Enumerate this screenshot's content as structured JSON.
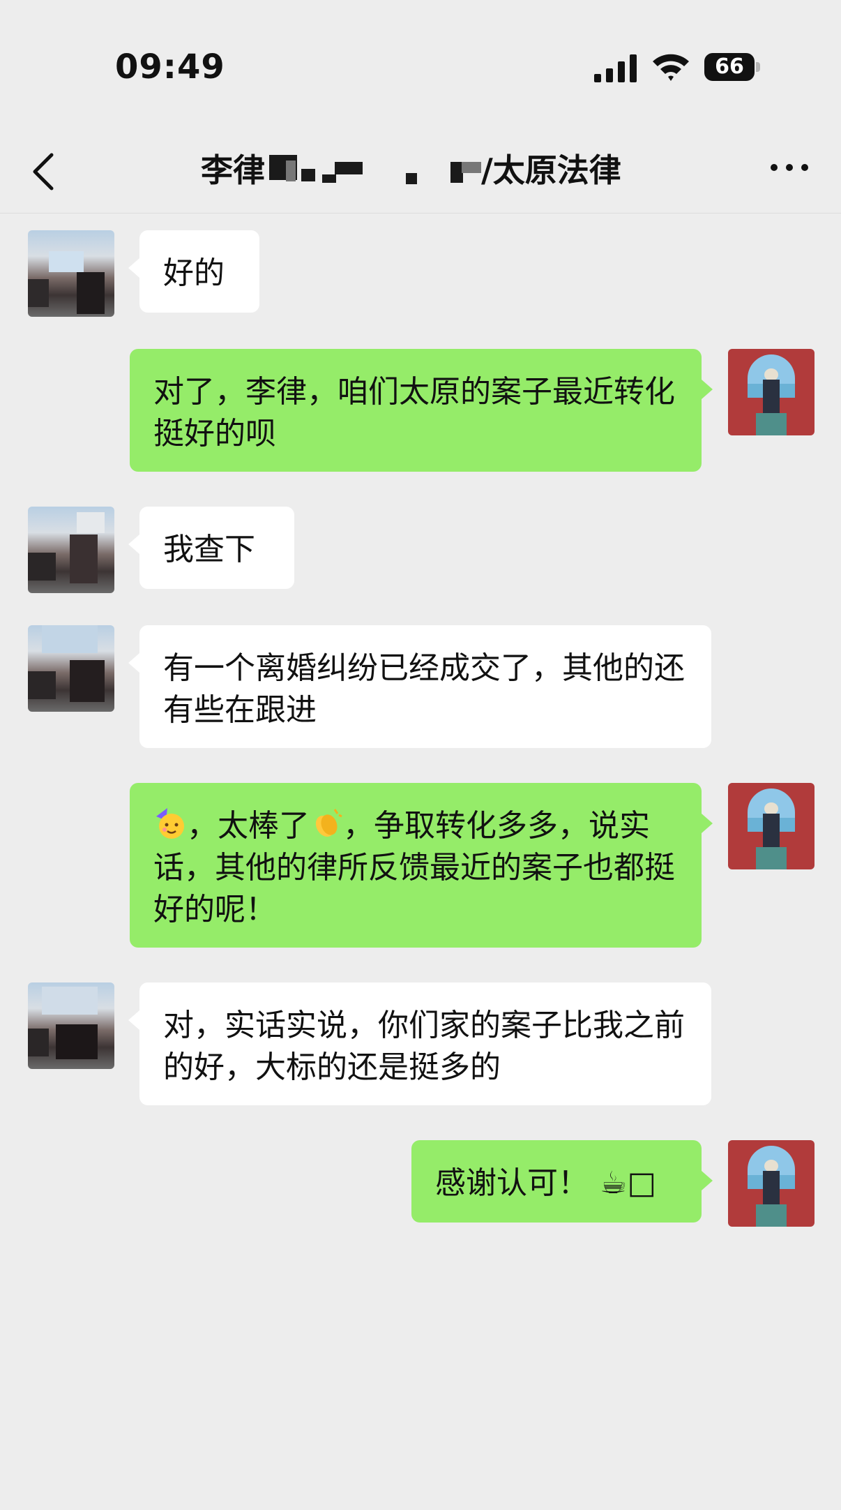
{
  "status_bar": {
    "time": "09:49",
    "battery": "66"
  },
  "nav": {
    "title_prefix": "李律",
    "title_suffix": "/太原法律"
  },
  "messages": [
    {
      "side": "left",
      "text": "好的"
    },
    {
      "side": "right",
      "text": "对了，李律，咱们太原的案子最近转化挺好的呗"
    },
    {
      "side": "left",
      "text": "我查下"
    },
    {
      "side": "left",
      "text": "有一个离婚纠纷已经成交了，其他的还有些在跟进"
    },
    {
      "side": "right",
      "parts": [
        "，太棒了",
        "，争取转化多多，说实话，其他的律所反馈最近的案子也都挺好的呢！"
      ],
      "icons": [
        "party-face-emoji",
        "clapping-hands-emoji"
      ]
    },
    {
      "side": "left",
      "text": "对，实话实说，你们家的案子比我之前的好，大标的还是挺多的"
    },
    {
      "side": "right",
      "text": "感谢认可！",
      "trailing": "☕□",
      "icons": [
        "coffee-emoji"
      ]
    }
  ]
}
